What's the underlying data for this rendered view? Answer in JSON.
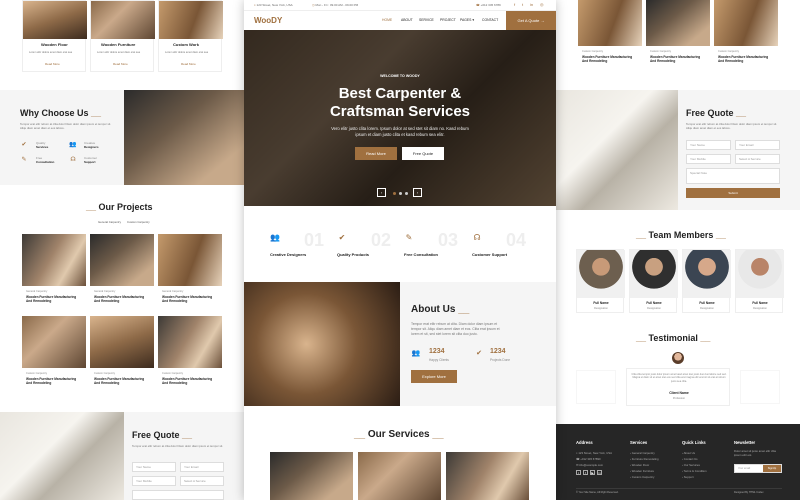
{
  "colors": {
    "brand": "#a0703f",
    "dark": "#262626"
  },
  "left": {
    "top_cards": [
      {
        "title": "Wooden Floor",
        "desc": "Lorem elitr dolore amet diam erat sea",
        "link": "Read More"
      },
      {
        "title": "Wooden Furniture",
        "desc": "Lorem elitr dolore amet diam erat sea",
        "link": "Read More"
      },
      {
        "title": "Custom Work",
        "desc": "Lorem elitr dolore amet diam erat sea",
        "link": "Read More"
      }
    ],
    "why": {
      "title": "Why Choose Us",
      "text": "Tempor erat elitr rebum at clita dolor Diam dolor diam ipsum et tempor sit. Aliqu diam amet diam et eos labore.",
      "items": [
        {
          "l1": "Quality",
          "l2": "Services"
        },
        {
          "l1": "Creative",
          "l2": "Designers"
        },
        {
          "l1": "Free",
          "l2": "Consultation"
        },
        {
          "l1": "Customer",
          "l2": "Support"
        }
      ]
    },
    "projects": {
      "title": "Our Projects",
      "filter": [
        "General Carpentry",
        "Custom Carpentry"
      ],
      "cards": [
        {
          "cat": "General Carpentry",
          "l1": "Wooden Furniture Manufacturing",
          "l2": "And Remodeling"
        },
        {
          "cat": "General Carpentry",
          "l1": "Wooden Furniture Manufacturing",
          "l2": "And Remodeling"
        },
        {
          "cat": "General Carpentry",
          "l1": "Wooden Furniture Manufacturing",
          "l2": "And Remodeling"
        },
        {
          "cat": "Custom Carpentry",
          "l1": "Wooden Furniture Manufacturing",
          "l2": "And Remodeling"
        },
        {
          "cat": "Custom Carpentry",
          "l1": "Wooden Furniture Manufacturing",
          "l2": "And Remodeling"
        },
        {
          "cat": "Custom Carpentry",
          "l1": "Wooden Furniture Manufacturing",
          "l2": "And Remodeling"
        }
      ]
    },
    "quote": {
      "title": "Free Quote",
      "text": "Tempor erat elitr rebum at clita dolor Diam dolor diam ipsum et tempor sit.",
      "fields": [
        "Your Name",
        "Your Email",
        "Your Mobile",
        "Select A Service"
      ]
    }
  },
  "center": {
    "topbar": {
      "address": "123 Street, New York, USA",
      "hours": "Mon - Fri : 09.00 AM - 09.00 PM",
      "phone": "+012 345 6789"
    },
    "nav": {
      "logo": "WooDY",
      "items": [
        "HOME",
        "ABOUT",
        "SERVICE",
        "PROJECT",
        "PAGES",
        "CONTACT"
      ],
      "cta": "Get A Quote"
    },
    "hero": {
      "kicker": "WELCOME TO WOODY",
      "title1": "Best Carpenter &",
      "title2": "Craftsman Services",
      "sub1": "Vero elitr justo clita lorem. Ipsum dolor at sed stet sit diam no. Kasd rebum",
      "sub2": "ipsum et diam justo clita et kasd rebum sea elitr.",
      "btn1": "Read More",
      "btn2": "Free Quote"
    },
    "features": [
      {
        "num": "01",
        "label": "Creative Designers"
      },
      {
        "num": "02",
        "label": "Quality Products"
      },
      {
        "num": "03",
        "label": "Free Consultation"
      },
      {
        "num": "04",
        "label": "Customer Support"
      }
    ],
    "about": {
      "title": "About Us",
      "text1": "Tempor erat elitr rebum at clita. Diam dolor diam ipsum et",
      "text2": "tempor sit. Aliqu diam amet diam et eos. Clita erat ipsum et",
      "text3": "lorem et sit, sed stet lorem sit clita duo justo.",
      "stats": [
        {
          "num": "1234",
          "label": "Happy Clients"
        },
        {
          "num": "1234",
          "label": "Projects Done"
        }
      ],
      "btn": "Explore More"
    },
    "services": {
      "title": "Our Services"
    }
  },
  "right": {
    "top_cards": [
      {
        "cat": "Custom Carpentry",
        "l1": "Wooden Furniture Manufacturing",
        "l2": "And Remodeling"
      },
      {
        "cat": "Custom Carpentry",
        "l1": "Wooden Furniture Manufacturing",
        "l2": "And Remodeling"
      },
      {
        "cat": "Custom Carpentry",
        "l1": "Wooden Furniture Manufacturing",
        "l2": "And Remodeling"
      }
    ],
    "quote": {
      "title": "Free Quote",
      "text": "Tempor erat elitr rebum at clita dolor Diam dolor diam ipsum et tempor sit. Aliqu diam amet diam et eos labore.",
      "fields": [
        "Your Name",
        "Your Email",
        "Your Mobile",
        "Select A Service",
        "Special Note"
      ],
      "btn": "Submit"
    },
    "team": {
      "title": "Team Members",
      "members": [
        {
          "name": "Full Name",
          "role": "Designation"
        },
        {
          "name": "Full Name",
          "role": "Designation"
        },
        {
          "name": "Full Name",
          "role": "Designation"
        },
        {
          "name": "Full Name",
          "role": "Designation"
        }
      ]
    },
    "testimonial": {
      "title": "Testimonial",
      "text": "Clita clita tempor justo dolor ipsum amet kasd amet duo justo duo duo labore sed sed. Magna ut diam sit et amet stet eos sed clita erat magna elitr erat sit sit erat at rebum justo sea clita.",
      "name": "Client Name",
      "role": "Profession"
    },
    "footer": {
      "cols": [
        {
          "title": "Address",
          "items": [
            "123 Street, New York, USA",
            "+012 345 67890",
            "info@example.com"
          ]
        },
        {
          "title": "Services",
          "items": [
            "General Carpentry",
            "Furniture Remodeling",
            "Wooden Floor",
            "Wooden Furniture",
            "Custom Carpentry"
          ]
        },
        {
          "title": "Quick Links",
          "items": [
            "About Us",
            "Contact Us",
            "Our Services",
            "Terms & Condition",
            "Support"
          ]
        },
        {
          "title": "Newsletter",
          "items": [
            "Dolor amet sit justo amet elitr clita ipsum elitr est."
          ]
        }
      ],
      "email_placeholder": "Your email",
      "signup": "SignUp",
      "copyright": "© Your Site Name, All Right Reserved.",
      "designed": "Designed By HTML Codex"
    }
  }
}
